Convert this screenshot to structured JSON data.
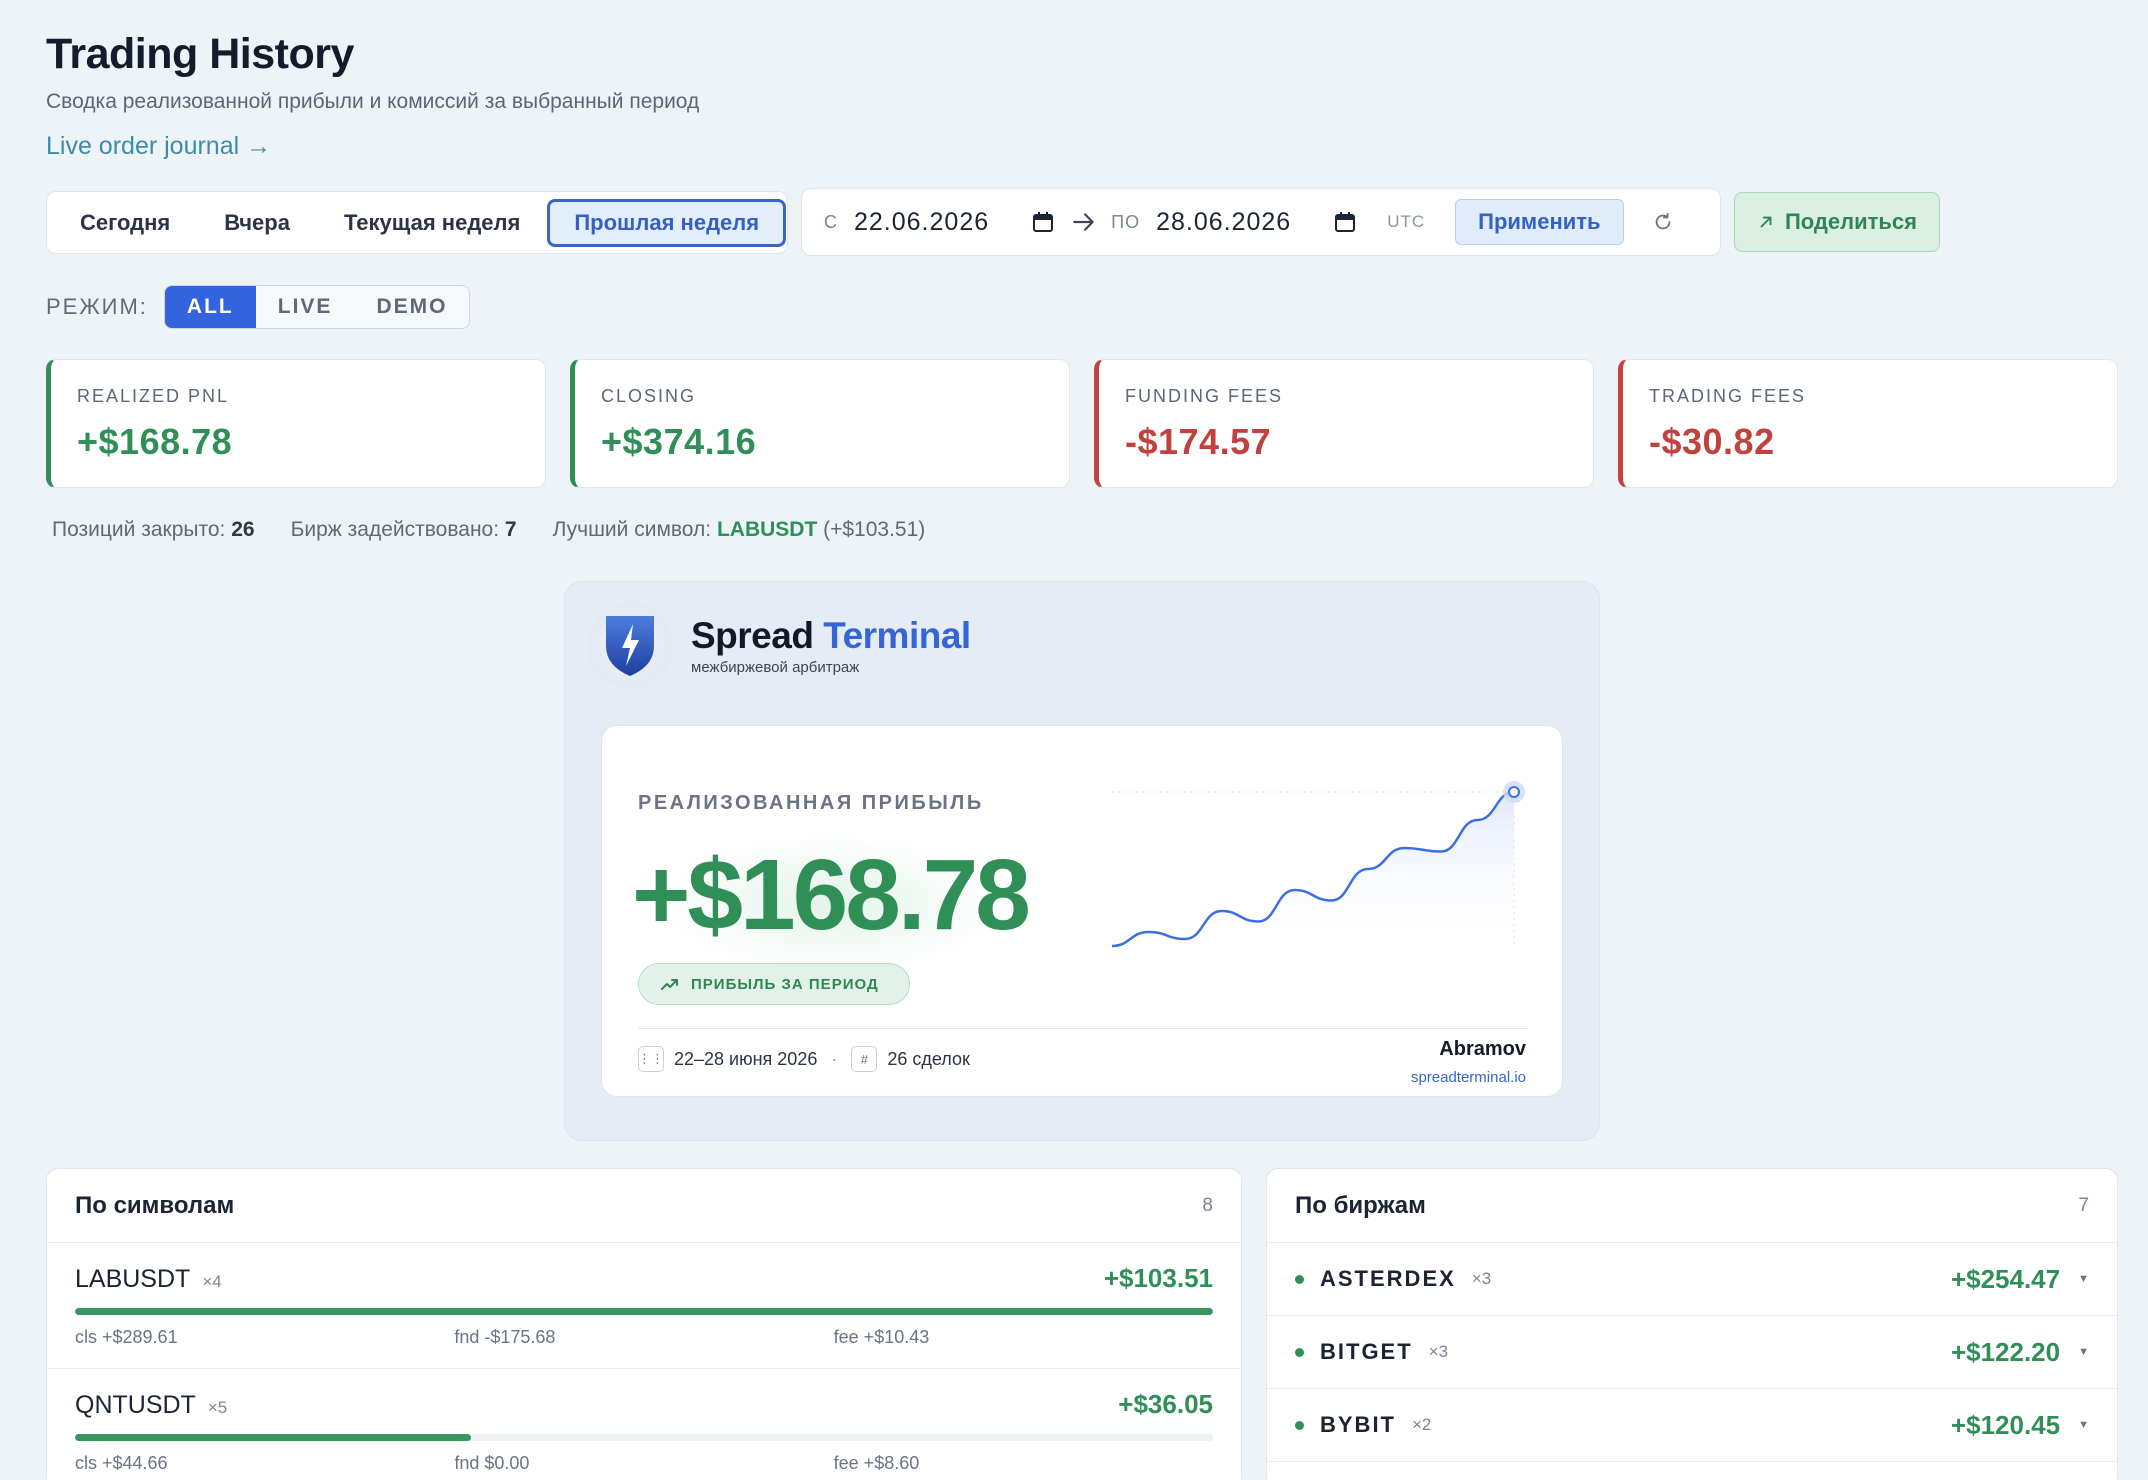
{
  "header": {
    "title": "Trading History",
    "subtitle": "Сводка реализованной прибыли и комиссий за выбранный период",
    "journal_link": "Live order journal →"
  },
  "periods": [
    {
      "label": "Сегодня",
      "active": false
    },
    {
      "label": "Вчера",
      "active": false
    },
    {
      "label": "Текущая неделя",
      "active": false
    },
    {
      "label": "Прошлая неделя",
      "active": true
    }
  ],
  "daterange": {
    "from_label": "С",
    "from_value": "22.06.2026",
    "to_label": "ПО",
    "to_value": "28.06.2026",
    "tz": "UTC",
    "apply": "Применить"
  },
  "share_label": "Поделиться",
  "mode": {
    "label": "РЕЖИМ:",
    "options": [
      "ALL",
      "LIVE",
      "DEMO"
    ],
    "active": "ALL"
  },
  "kpis": [
    {
      "label": "REALIZED PNL",
      "value": "+$168.78",
      "sign": "pos"
    },
    {
      "label": "CLOSING",
      "value": "+$374.16",
      "sign": "pos"
    },
    {
      "label": "FUNDING FEES",
      "value": "-$174.57",
      "sign": "neg"
    },
    {
      "label": "TRADING FEES",
      "value": "-$30.82",
      "sign": "neg"
    }
  ],
  "stats": {
    "closed_label": "Позиций закрыто:",
    "closed_value": "26",
    "exchanges_label": "Бирж задействовано:",
    "exchanges_value": "7",
    "best_label": "Лучший символ:",
    "best_symbol": "LABUSDT",
    "best_value": "(+$103.51)"
  },
  "share_card": {
    "brand_word1": "Spread",
    "brand_word2": "Terminal",
    "brand_sub": "межбиржевой арбитраж",
    "label": "РЕАЛИЗОВАННАЯ ПРИБЫЛЬ",
    "value": "+$168.78",
    "pill": "ПРИБЫЛЬ ЗА ПЕРИОД",
    "period": "22–28 июня 2026",
    "trades": "26 сделок",
    "author": "Abramov",
    "site": "spreadterminal.io",
    "sparkline": [
      2,
      6,
      4,
      12,
      9,
      18,
      15,
      24,
      30,
      29,
      38,
      46
    ]
  },
  "symbols_panel": {
    "title": "По символам",
    "count": "8",
    "rows": [
      {
        "symbol": "LABUSDT",
        "mult": "×4",
        "value": "+$103.51",
        "fill": 1.0,
        "cls": "cls +$289.61",
        "fnd": "fnd -$175.68",
        "fee": "fee +$10.43"
      },
      {
        "symbol": "QNTUSDT",
        "mult": "×5",
        "value": "+$36.05",
        "fill": 0.348,
        "cls": "cls +$44.66",
        "fnd": "fnd $0.00",
        "fee": "fee +$8.60"
      }
    ]
  },
  "exchanges_panel": {
    "title": "По биржам",
    "count": "7",
    "rows": [
      {
        "name": "ASTERDEX",
        "mult": "×3",
        "value": "+$254.47"
      },
      {
        "name": "BITGET",
        "mult": "×3",
        "value": "+$122.20"
      },
      {
        "name": "BYBIT",
        "mult": "×2",
        "value": "+$120.45"
      }
    ]
  },
  "colors": {
    "accent": "#3463de",
    "positive": "#2f8f57",
    "negative": "#c0413d",
    "background": "#eef3f8"
  }
}
